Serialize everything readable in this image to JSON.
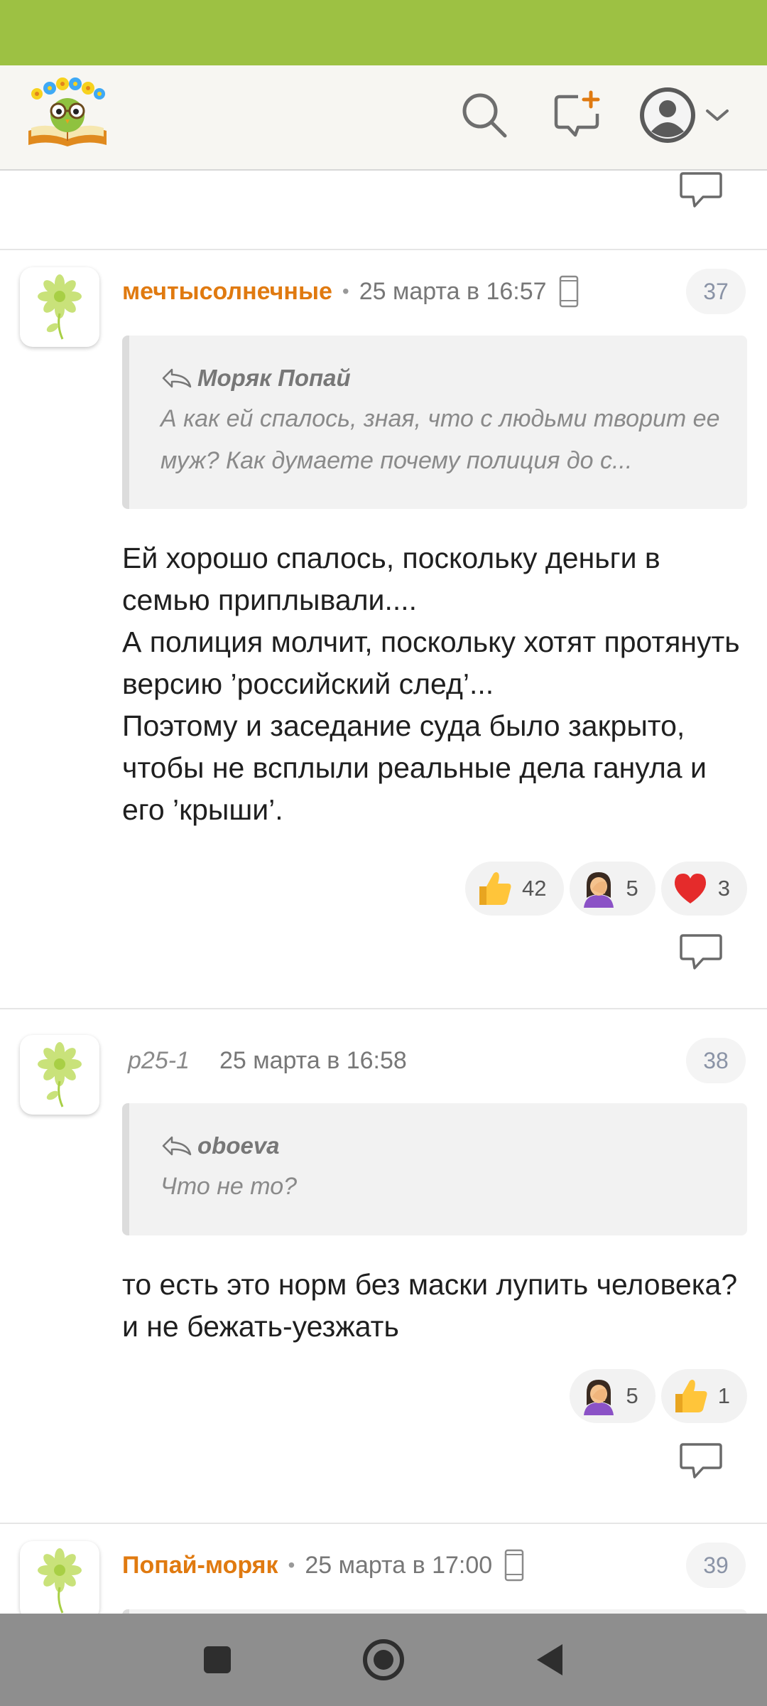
{
  "colors": {
    "status_bar": "#9dc143",
    "accent_author": "#e07a10",
    "nav_bar": "#8e8e8e"
  },
  "header": {
    "logo_icon": "book-flower-owl-logo",
    "search_icon": "search-icon",
    "new_post_icon": "new-message-plus-icon",
    "profile_icon": "user-avatar-icon",
    "menu_icon": "chevron-down-icon"
  },
  "comments": [
    {
      "author": "мечтысолнечные",
      "time": "25 марта в 16:57",
      "number": "37",
      "device_icon": "mobile-phone-icon",
      "quote": {
        "author": "Моряк Попай",
        "text": "А как ей спалось, зная, что с людьми творит ее муж? Как думаете почему полиция до с..."
      },
      "body": "Ей хорошо спалось, поскольку деньги в семью приплывали....\nА полиция молчит, поскольку хотят протянуть версию ’российский след’...\nПоэтому и заседание суда было закрыто, чтобы не всплыли реальные дела ганула и его ’крыши’.",
      "reactions": [
        {
          "icon": "thumbs-up-icon",
          "count": "42"
        },
        {
          "icon": "facepalm-icon",
          "count": "5"
        },
        {
          "icon": "heart-icon",
          "count": "3"
        }
      ]
    },
    {
      "author": "p25-1",
      "time": "25 марта в 16:58",
      "number": "38",
      "quote": {
        "author": "oboeva",
        "text": "Что не то?"
      },
      "body": "то есть это норм без маски лупить человека? и не бежать-уезжать",
      "reactions": [
        {
          "icon": "facepalm-icon",
          "count": "5"
        },
        {
          "icon": "thumbs-up-icon",
          "count": "1"
        }
      ]
    },
    {
      "author": "Попай-моряк",
      "time": "25 марта в 17:00",
      "number": "39",
      "device_icon": "mobile-phone-icon"
    }
  ]
}
